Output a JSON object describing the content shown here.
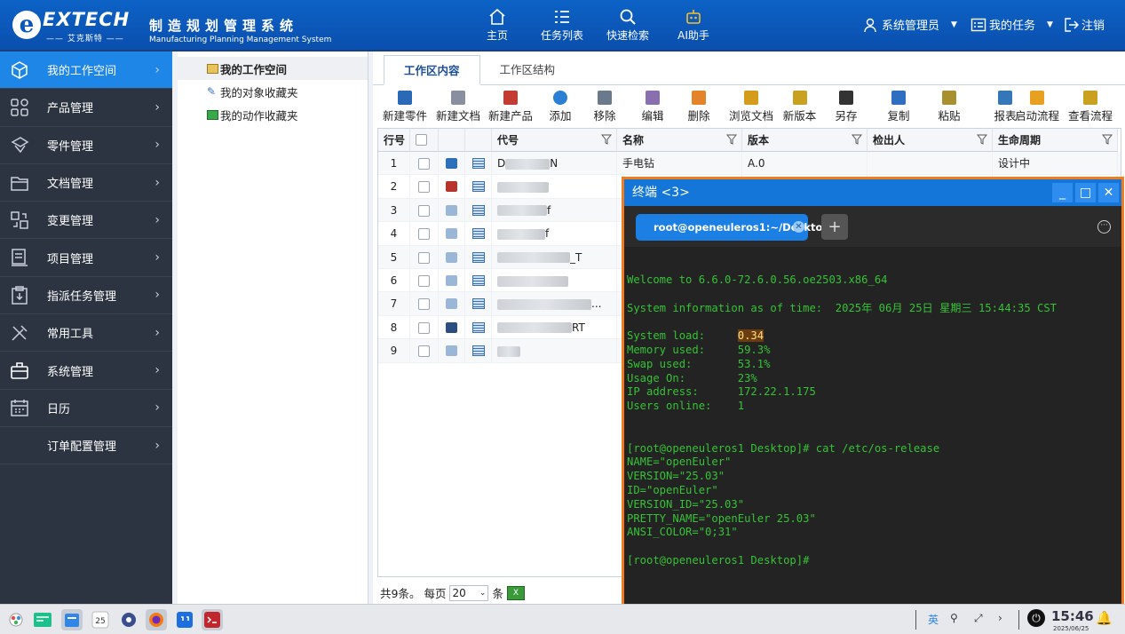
{
  "header": {
    "logo_text": "EXTECH",
    "logo_sub": "—— 艾克斯特 ——",
    "system_title_cn": "制造规划管理系统",
    "system_title_en": "Manufacturing Planning Management System",
    "nav": [
      {
        "label": "主页",
        "icon": "home-icon"
      },
      {
        "label": "任务列表",
        "icon": "list-icon"
      },
      {
        "label": "快速检索",
        "icon": "search-icon"
      },
      {
        "label": "AI助手",
        "icon": "robot-icon"
      }
    ],
    "user_label": "系统管理员",
    "tasks_label": "我的任务",
    "logout_label": "注销"
  },
  "sidebar": {
    "items": [
      {
        "label": "我的工作空间",
        "icon": "cube-icon"
      },
      {
        "label": "产品管理",
        "icon": "grid-icon"
      },
      {
        "label": "零件管理",
        "icon": "part-icon"
      },
      {
        "label": "文档管理",
        "icon": "folder-icon"
      },
      {
        "label": "变更管理",
        "icon": "change-icon"
      },
      {
        "label": "项目管理",
        "icon": "project-icon"
      },
      {
        "label": "指派任务管理",
        "icon": "clipboard-icon"
      },
      {
        "label": "常用工具",
        "icon": "tools-icon"
      },
      {
        "label": "系统管理",
        "icon": "toolbox-icon"
      },
      {
        "label": "日历",
        "icon": "calendar-icon"
      },
      {
        "label": "订单配置管理",
        "icon": ""
      }
    ]
  },
  "tree": {
    "items": [
      "我的工作空间",
      "我的对象收藏夹",
      "我的动作收藏夹"
    ]
  },
  "main": {
    "tabs": [
      "工作区内容",
      "工作区结构"
    ],
    "toolbar": [
      "新建零件",
      "新建文档",
      "新建产品",
      "添加",
      "移除",
      "编辑",
      "删除",
      "浏览文档",
      "新版本",
      "另存",
      "复制",
      "粘贴",
      "报表",
      "启动流程",
      "查看流程"
    ],
    "columns": [
      "行号",
      "代号",
      "名称",
      "版本",
      "检出人",
      "生命周期"
    ],
    "rows": [
      {
        "no": "1",
        "code": "D",
        "code_tail": "N",
        "name": "手电钻",
        "version": "A.0",
        "checkout": "",
        "lifecycle": "设计中"
      },
      {
        "no": "2",
        "code": "",
        "code_tail": "",
        "name": "",
        "version": "",
        "checkout": "",
        "lifecycle": ""
      },
      {
        "no": "3",
        "code": "",
        "code_tail": "f",
        "name": "",
        "version": "",
        "checkout": "",
        "lifecycle": ""
      },
      {
        "no": "4",
        "code": "",
        "code_tail": "f",
        "name": "",
        "version": "",
        "checkout": "",
        "lifecycle": ""
      },
      {
        "no": "5",
        "code": "",
        "code_tail": "_T",
        "name": "",
        "version": "",
        "checkout": "",
        "lifecycle": ""
      },
      {
        "no": "6",
        "code": "",
        "code_tail": "",
        "name": "",
        "version": "",
        "checkout": "",
        "lifecycle": ""
      },
      {
        "no": "7",
        "code": "",
        "code_tail": "...",
        "name": "",
        "version": "",
        "checkout": "",
        "lifecycle": ""
      },
      {
        "no": "8",
        "code": "",
        "code_tail": "RT",
        "name": "",
        "version": "",
        "checkout": "",
        "lifecycle": ""
      },
      {
        "no": "9",
        "code": "",
        "code_tail": "",
        "name": "",
        "version": "",
        "checkout": "",
        "lifecycle": ""
      }
    ],
    "pager": {
      "total_text": "共9条。",
      "per_page_label": "每页",
      "per_page": "20",
      "unit": "条"
    }
  },
  "terminal": {
    "title": "终端 <3>",
    "tab_label": "root@openeuleros1:~/Desktop",
    "lines": [
      "Welcome to 6.6.0-72.6.0.56.oe2503.x86_64",
      "",
      "System information as of time:  2025年 06月 25日 星期三 15:44:35 CST",
      "",
      "System load:     ",
      "Memory used:     59.3%",
      "Swap used:       53.1%",
      "Usage On:        23%",
      "IP address:      172.22.1.175",
      "Users online:    1",
      "",
      "",
      "[root@openeuleros1 Desktop]# cat /etc/os-release",
      "NAME=\"openEuler\"",
      "VERSION=\"25.03\"",
      "ID=\"openEuler\"",
      "VERSION_ID=\"25.03\"",
      "PRETTY_NAME=\"openEuler 25.03\"",
      "ANSI_COLOR=\"0;31\"",
      "",
      "[root@openeuleros1 Desktop]#"
    ],
    "system_load": "0.34"
  },
  "taskbar": {
    "calendar_day": "25",
    "time": "15:46",
    "date": "2025/06/25",
    "ime": "英"
  },
  "colors": {
    "header": "#0b58bb",
    "sidebar": "#2d3441",
    "active": "#1e86e6",
    "terminal_border": "#f07c1e",
    "terminal_text": "#36c236"
  }
}
